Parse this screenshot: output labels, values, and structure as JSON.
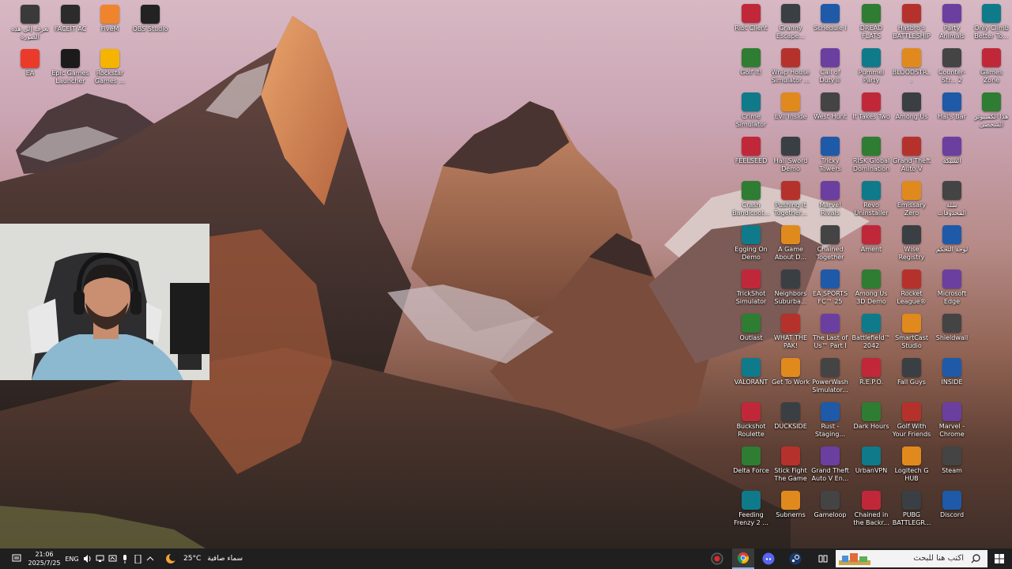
{
  "desktop_icons_left": [
    {
      "label": "تعرف إلى هذه الصورة",
      "icon": "camera-icon",
      "color": "#3a3a3a"
    },
    {
      "label": "FACEIT AC",
      "icon": "faceit-icon",
      "color": "#2b2b2b"
    },
    {
      "label": "FiveM",
      "icon": "fivem-icon",
      "color": "#f0842c"
    },
    {
      "label": "OBS Studio",
      "icon": "obs-icon",
      "color": "#222222"
    },
    {
      "label": "EA",
      "icon": "ea-icon",
      "color": "#ea3b2a"
    },
    {
      "label": "Epic Games Launcher",
      "icon": "epic-icon",
      "color": "#1b1b1b"
    },
    {
      "label": "Rockstar Games ...",
      "icon": "rockstar-icon",
      "color": "#f5b400"
    }
  ],
  "desktop_icons_right": [
    [
      "Riot Client",
      "Granny Escape...",
      "Schedule I",
      "DREAD FLATS Demo",
      "Hasbro's BATTLESHIP",
      "Party Animals",
      "Only Climb Better To..."
    ],
    [
      "",
      "Golf It!",
      "Wrap House Simulator ...",
      "Call of Duty®",
      "Pummel Party",
      "BLOODSTR...",
      "Counter-Str... 2",
      "Games Zone"
    ],
    [
      "",
      "Crime Simulator",
      "Evil Inside",
      "West Hunt",
      "It Takes Two",
      "Among Us",
      "Hal's Bar",
      "هذا الكمبيوتر الشخصي"
    ],
    [
      "",
      "FEELSEED",
      "Hali Sword Demo",
      "Tricky Towers",
      "RISK Global Domination",
      "Grand Theft Auto V",
      "الشبكة"
    ],
    [
      "",
      "Crash Bandicoot...",
      "Pushing It Together...",
      "Marvel Rivals",
      "Revo Uninstaller",
      "Emissary Zero",
      "سلة المحذوفات"
    ],
    [
      "",
      "Egging On Demo",
      "A Game About D...",
      "Chained Together",
      "Ament",
      "Wise Registry Cleaner",
      "لوحة التحكم"
    ],
    [
      "",
      "TrickShot Simulator",
      "Neighbors Suburba...",
      "EA SPORTS FC™ 25",
      "Among Us 3D Demo",
      "Rocket League®",
      "Microsoft Edge"
    ],
    [
      "",
      "Outlast",
      "WHAT THE PAK!",
      "The Last of Us™ Part I",
      "Battlefield™ 2042",
      "SmartCast Studio",
      "Shieldwall"
    ],
    [
      "",
      "VALORANT",
      "Get To Work",
      "PowerWash Simulator...",
      "R.E.P.O.",
      "Fall Guys",
      "INSIDE"
    ],
    [
      "",
      "Buckshot Roulette",
      "DUCKSIDE",
      "Rust - Staging...",
      "Dark Hours",
      "Golf With Your Friends",
      "Marvel - Chrome"
    ],
    [
      "",
      "Delta Force",
      "Stick Fight The Game",
      "Grand Theft Auto V En...",
      "UrbanVPN",
      "Logitech G HUB",
      "Steam"
    ],
    [
      "",
      "Feeding Frenzy 2 ...",
      "Subnerns",
      "Gameloop",
      "Chained in the Backr...",
      "PUBG BATTLEGR...",
      "Discord"
    ]
  ],
  "right_icon_colors": [
    "#c0283a",
    "#3a3f44",
    "#1e5aa8",
    "#2e7d32",
    "#b5322c",
    "#6b3fa0",
    "#0f7a8a",
    "#e08a1e",
    "#444444"
  ],
  "taskbar": {
    "time": "21:06",
    "date": "2025/7/25",
    "lang": "ENG",
    "weather_temp": "25°C",
    "weather_text": "سماء صافية",
    "search_placeholder": "اكتب هنا للبحث"
  }
}
